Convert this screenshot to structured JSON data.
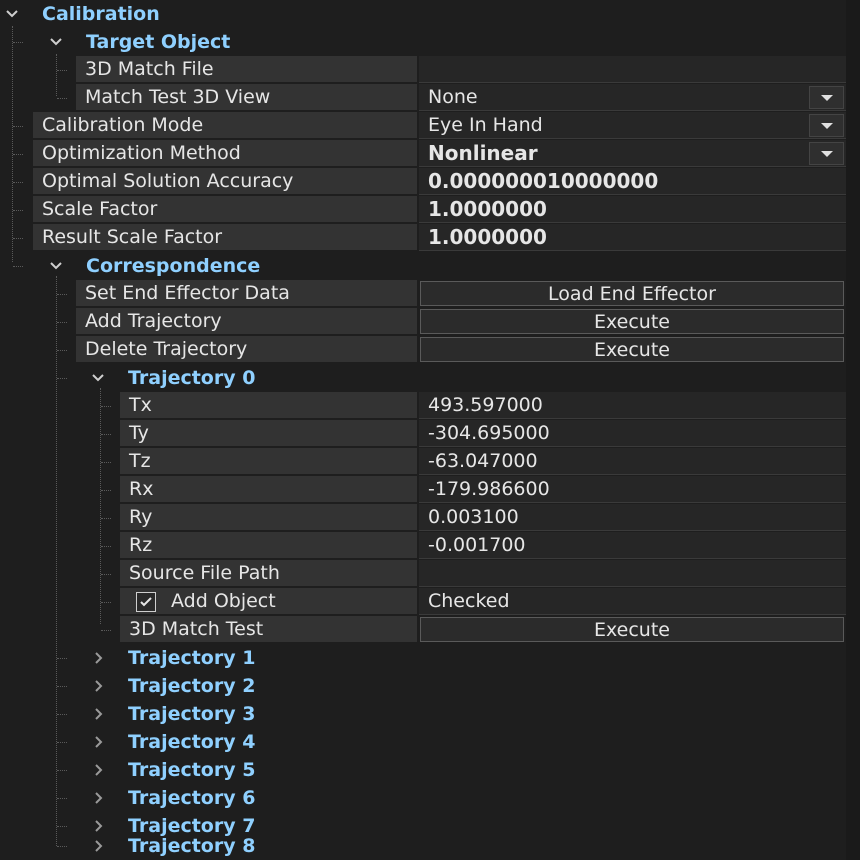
{
  "calibration": {
    "title": "Calibration",
    "target_object": {
      "title": "Target Object",
      "match_file_label": "3D Match File",
      "match_file_value": "",
      "match_view_label": "Match Test 3D View",
      "match_view_value": "None"
    },
    "calibration_mode_label": "Calibration Mode",
    "calibration_mode_value": "Eye In Hand",
    "optimization_method_label": "Optimization Method",
    "optimization_method_value": "Nonlinear",
    "accuracy_label": "Optimal Solution Accuracy",
    "accuracy_value": "0.000000010000000",
    "scale_factor_label": "Scale Factor",
    "scale_factor_value": "1.0000000",
    "result_scale_factor_label": "Result Scale Factor",
    "result_scale_factor_value": "1.0000000",
    "correspondence": {
      "title": "Correspondence",
      "set_end_effector_label": "Set End Effector Data",
      "set_end_effector_button": "Load End Effector",
      "add_trajectory_label": "Add Trajectory",
      "add_trajectory_button": "Execute",
      "delete_trajectory_label": "Delete Trajectory",
      "delete_trajectory_button": "Execute",
      "trajectory0": {
        "title": "Trajectory 0",
        "fields": [
          {
            "label": "Tx",
            "value": "493.597000"
          },
          {
            "label": "Ty",
            "value": "-304.695000"
          },
          {
            "label": "Tz",
            "value": "-63.047000"
          },
          {
            "label": "Rx",
            "value": "-179.986600"
          },
          {
            "label": "Ry",
            "value": "0.003100"
          },
          {
            "label": "Rz",
            "value": "-0.001700"
          }
        ],
        "source_path_label": "Source File Path",
        "source_path_value": "",
        "add_object_label": "Add Object",
        "add_object_value": "Checked",
        "match_test_label": "3D Match Test",
        "match_test_button": "Execute"
      },
      "collapsed_trajectories": [
        "Trajectory 1",
        "Trajectory 2",
        "Trajectory 3",
        "Trajectory 4",
        "Trajectory 5",
        "Trajectory 6",
        "Trajectory 7",
        "Trajectory 8"
      ]
    }
  },
  "icons": {
    "expanded": "chevron-down-icon",
    "collapsed": "chevron-right-icon",
    "dropdown": "dropdown-arrow-icon",
    "checkbox": "checkbox-checked-icon"
  }
}
